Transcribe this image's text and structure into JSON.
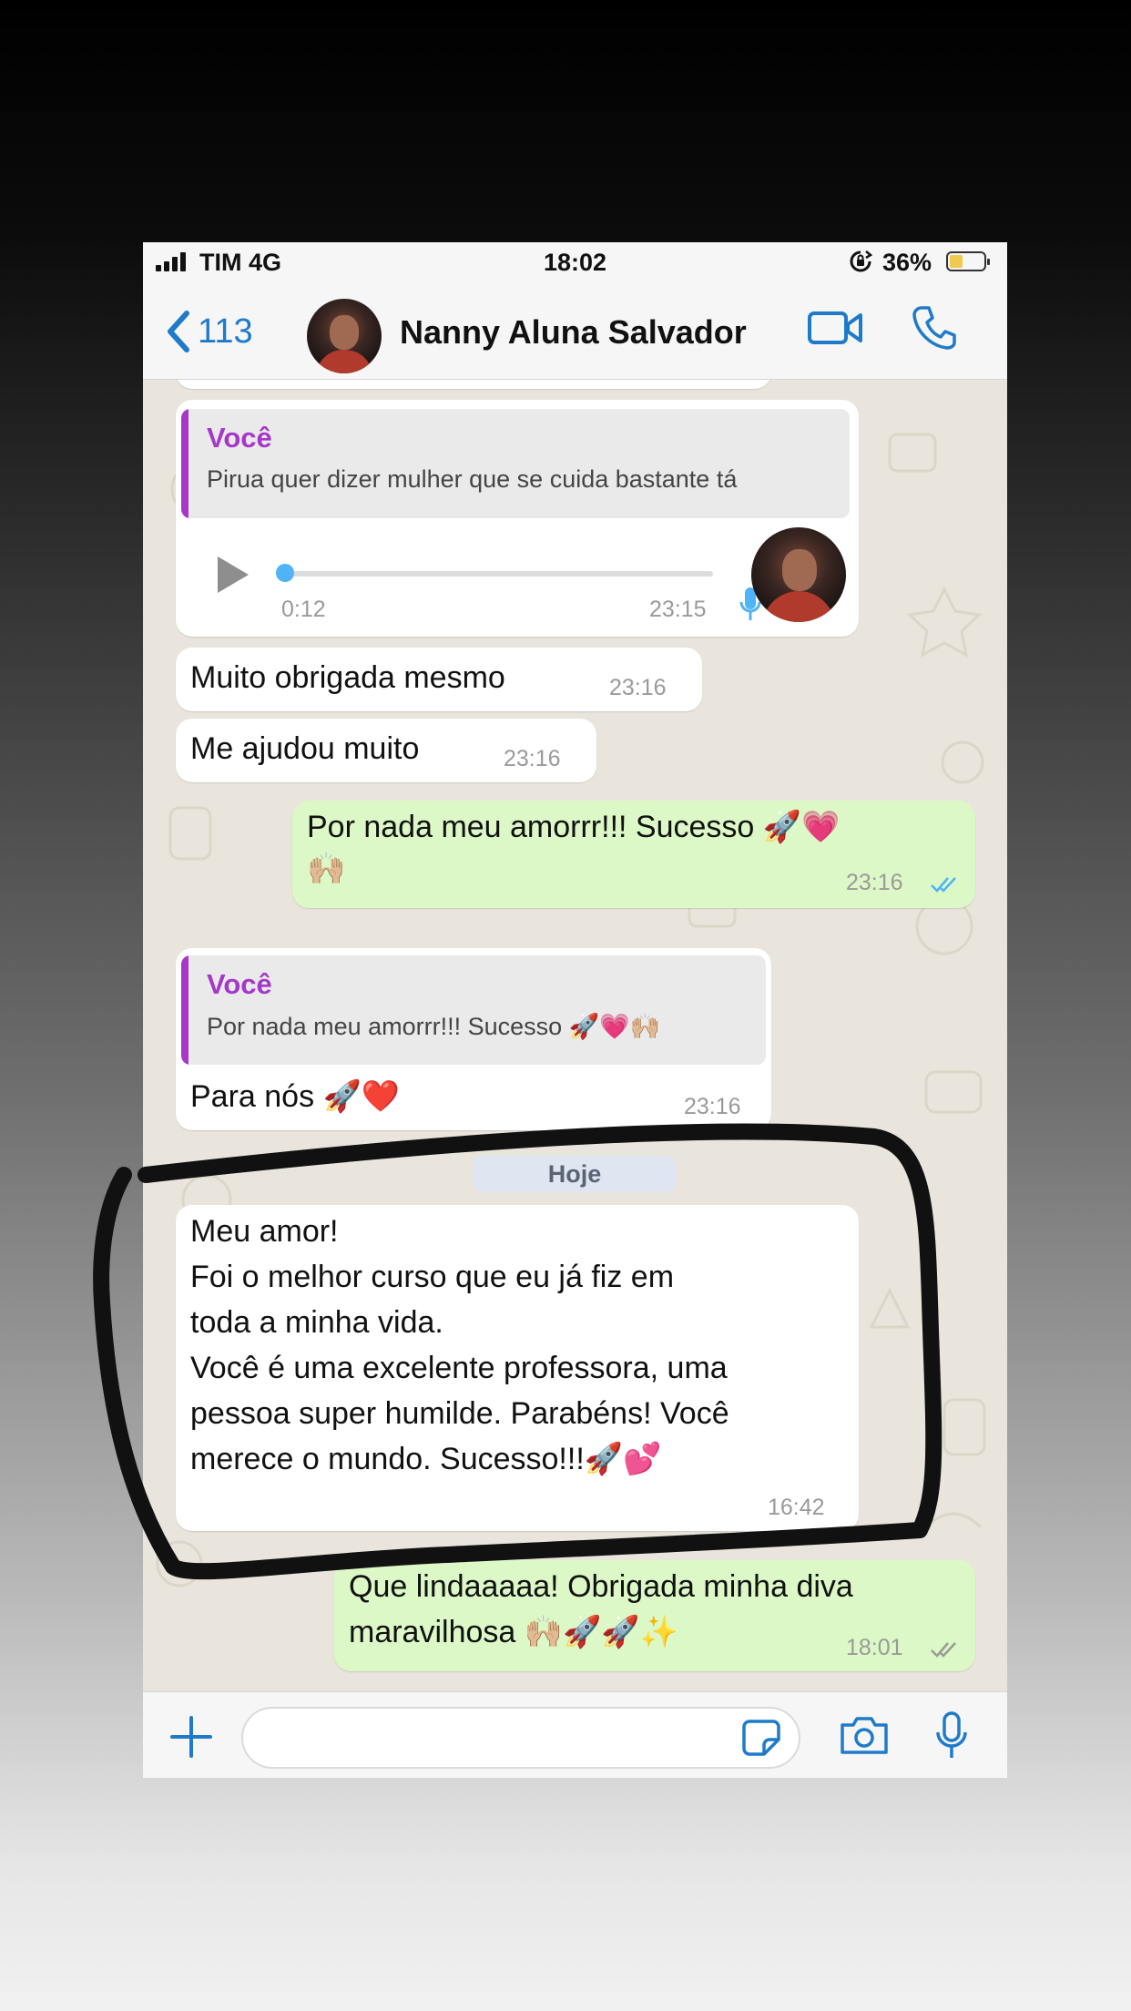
{
  "status_bar": {
    "carrier": "TIM 4G",
    "time": "18:02",
    "battery": "36%",
    "battery_level": 0.36
  },
  "header": {
    "back_count": "113",
    "contact_name": "Nanny Aluna Salvador"
  },
  "messages": {
    "m1_quote_author": "Você",
    "m1_quote_text": "Pirua quer dizer mulher que se cuida bastante tá",
    "m1_audio_duration": "0:12",
    "m1_time": "23:15",
    "m2_text": "Muito obrigada mesmo",
    "m2_time": "23:16",
    "m3_text": "Me ajudou muito",
    "m3_time": "23:16",
    "m4_line1": "Por nada meu amorrr!!! Sucesso 🚀💗",
    "m4_line2": "🙌🏼",
    "m4_time": "23:16",
    "m5_quote_author": "Você",
    "m5_quote_text": "Por nada meu amorrr!!! Sucesso 🚀💗🙌🏼",
    "m5_text": "Para nós 🚀❤️",
    "m5_time": "23:16",
    "date_divider": "Hoje",
    "m6_line1": "Meu amor!",
    "m6_line2": "Foi o melhor curso que eu já fiz em",
    "m6_line3": "toda a minha vida.",
    "m6_line4": "Você é uma excelente professora, uma",
    "m6_line5": "pessoa super humilde. Parabéns! Você",
    "m6_line6": "merece o mundo. Sucesso!!!🚀💕",
    "m6_time": "16:42",
    "m7_line1": "Que lindaaaaa! Obrigada minha diva",
    "m7_line2": "maravilhosa 🙌🏼🚀🚀✨",
    "m7_time": "18:01"
  },
  "colors": {
    "accent": "#1f7bc9",
    "outgoing_bubble": "#dcf8c6",
    "quote_author": "#a638c9",
    "read_ticks": "#4fb3f6"
  },
  "icons": [
    "back-chevron-icon",
    "video-call-icon",
    "phone-icon",
    "play-icon",
    "mic-icon",
    "double-check-icon",
    "plus-icon",
    "sticker-icon",
    "camera-icon",
    "lock-rotation-icon",
    "battery-icon",
    "signal-icon"
  ]
}
